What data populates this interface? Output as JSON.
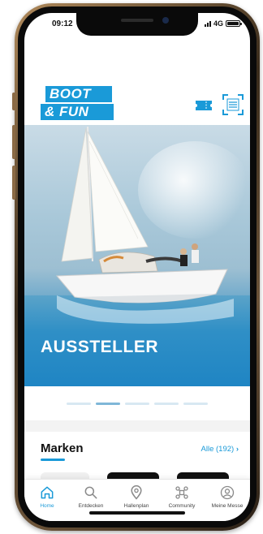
{
  "status_bar": {
    "time": "09:12",
    "network": "4G"
  },
  "header": {
    "logo_line1": "BOOT",
    "logo_line2": "& FUN"
  },
  "hero": {
    "title": "AUSSTELLER"
  },
  "carousel": {
    "pages": 5,
    "active_index": 1
  },
  "brands": {
    "title": "Marken",
    "all_label": "Alle (192)"
  },
  "tabbar": {
    "items": [
      {
        "label": "Home",
        "icon": "home-icon",
        "active": true
      },
      {
        "label": "Entdecken",
        "icon": "search-icon",
        "active": false
      },
      {
        "label": "Hallenplan",
        "icon": "map-pin-icon",
        "active": false
      },
      {
        "label": "Community",
        "icon": "network-icon",
        "active": false
      },
      {
        "label": "Meine Messe",
        "icon": "user-icon",
        "active": false
      }
    ]
  },
  "colors": {
    "accent": "#1a9ad8",
    "text": "#111111",
    "inactive": "#8a8a8a"
  }
}
